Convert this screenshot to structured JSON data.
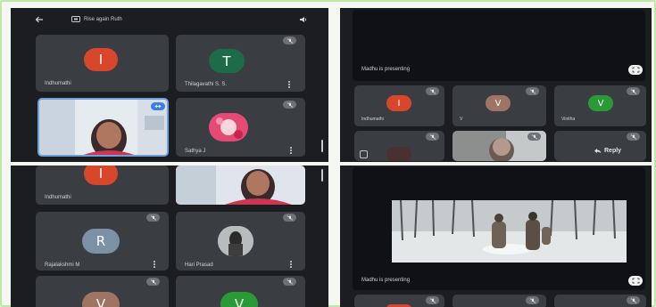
{
  "colors": {
    "tile_bg": "#3a3d42",
    "pane_bg": "#1b1d21",
    "avatar_red": "#d8472b",
    "avatar_green": "#1d6b47",
    "avatar_slate": "#7a91a6",
    "avatar_brown": "#a07463",
    "avatar_bright_green": "#2a9a36"
  },
  "top_left": {
    "header_label": "Rise again Ruth",
    "tiles": [
      {
        "initial": "I",
        "name": "Indhumathi"
      },
      {
        "initial": "T",
        "name": "Thilagavathi S. S."
      },
      {
        "initial": "",
        "name": "Sathya J"
      }
    ]
  },
  "top_right": {
    "presenting_label": "Madhu is presenting",
    "thumbs": [
      {
        "initial": "I",
        "name": "Indhumathi"
      },
      {
        "initial": "V",
        "name": "V"
      },
      {
        "initial": "V",
        "name": "Vinitha"
      }
    ],
    "reply_label": "Reply"
  },
  "bottom_left": {
    "tiles": [
      {
        "initial": "I",
        "name": "Indhumathi"
      },
      {
        "initial": "R",
        "name": "Rajalakshmi M"
      },
      {
        "initial": "",
        "name": "Hari Prasad"
      },
      {
        "initial": "V",
        "name": ""
      },
      {
        "initial": "V",
        "name": ""
      }
    ]
  },
  "bottom_right": {
    "presenting_label": "Madhu is presenting"
  },
  "icons": {
    "back": "arrow-left-icon",
    "present": "screen-share-icon",
    "audio": "volume-icon",
    "mic_off": "mic-off-icon",
    "more": "more-vert-icon",
    "pin": "pin-icon",
    "fullscreen": "fullscreen-icon",
    "reply": "reply-icon"
  }
}
